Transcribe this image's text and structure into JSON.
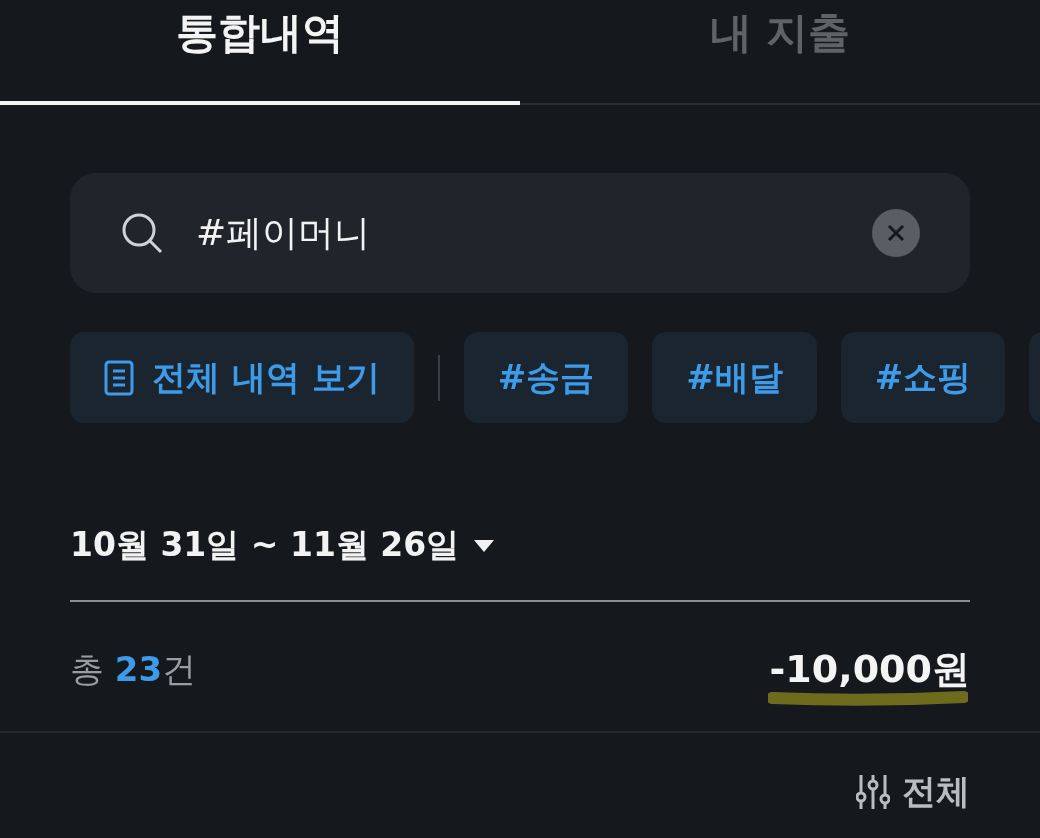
{
  "tabs": [
    {
      "label": "통합내역",
      "selected": true
    },
    {
      "label": "내 지출",
      "selected": false
    }
  ],
  "search": {
    "value": "#페이머니"
  },
  "chips": [
    {
      "kind": "all",
      "label": "전체 내역 보기"
    },
    {
      "kind": "tag",
      "label": "#송금"
    },
    {
      "kind": "tag",
      "label": "#배달"
    },
    {
      "kind": "tag",
      "label": "#쇼핑"
    },
    {
      "kind": "cut"
    }
  ],
  "date_range": "10월 31일 ~ 11월 26일",
  "summary": {
    "count": "총 **23**건",
    "amount": "-10,000원"
  },
  "filter": {
    "label": "전체"
  }
}
